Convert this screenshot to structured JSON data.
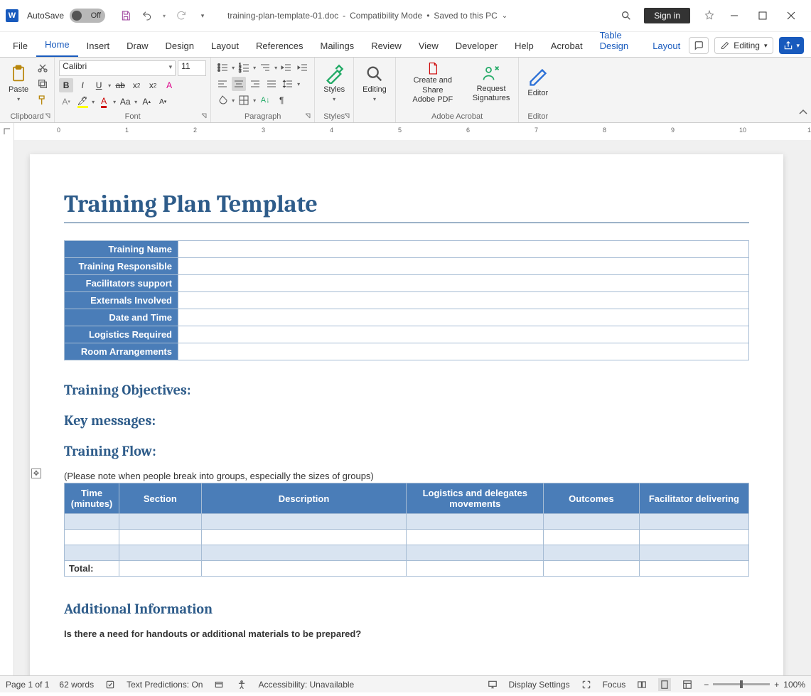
{
  "titlebar": {
    "autosave_label": "AutoSave",
    "autosave_state": "Off",
    "doc_name": "training-plan-template-01.doc",
    "mode": "Compatibility Mode",
    "save_state": "Saved to this PC",
    "signin": "Sign in"
  },
  "tabs": {
    "items": [
      "File",
      "Home",
      "Insert",
      "Draw",
      "Design",
      "Layout",
      "References",
      "Mailings",
      "Review",
      "View",
      "Developer",
      "Help",
      "Acrobat",
      "Table Design",
      "Layout"
    ],
    "active": "Home",
    "editing_label": "Editing"
  },
  "ribbon": {
    "clipboard": {
      "paste": "Paste",
      "label": "Clipboard"
    },
    "font": {
      "name": "Calibri",
      "size": "11",
      "label": "Font"
    },
    "paragraph": {
      "label": "Paragraph"
    },
    "styles": {
      "button": "Styles",
      "label": "Styles"
    },
    "editing": {
      "button": "Editing"
    },
    "acrobat": {
      "create": "Create and Share\nAdobe PDF",
      "request": "Request\nSignatures",
      "label": "Adobe Acrobat"
    },
    "editor": {
      "button": "Editor",
      "label": "Editor"
    }
  },
  "document": {
    "title": "Training Plan Template",
    "info_rows": [
      "Training Name",
      "Training Responsible",
      "Facilitators support",
      "Externals Involved",
      "Date and Time",
      "Logistics Required",
      "Room Arrangements"
    ],
    "h_objectives": "Training Objectives:",
    "h_messages": "Key messages:",
    "h_flow": "Training Flow:",
    "flow_note": "(Please note when people break into groups, especially the sizes of groups)",
    "flow_headers": [
      "Time (minutes)",
      "Section",
      "Description",
      "Logistics and delegates movements",
      "Outcomes",
      "Facilitator delivering"
    ],
    "flow_total": "Total:",
    "h_additional": "Additional Information",
    "additional_q": "Is there a need for handouts or additional materials to be prepared?"
  },
  "status": {
    "page": "Page 1 of 1",
    "words": "62 words",
    "predictions": "Text Predictions: On",
    "accessibility": "Accessibility: Unavailable",
    "display": "Display Settings",
    "focus": "Focus",
    "zoom": "100%"
  }
}
